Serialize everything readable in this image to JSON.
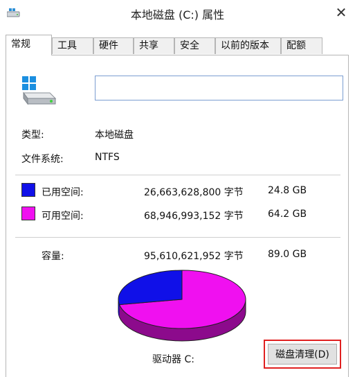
{
  "window": {
    "title": "本地磁盘 (C:) 属性",
    "close_glyph": "✕"
  },
  "tabs": [
    {
      "label": "常规",
      "active": true
    },
    {
      "label": "工具"
    },
    {
      "label": "硬件"
    },
    {
      "label": "共享"
    },
    {
      "label": "安全"
    },
    {
      "label": "以前的版本"
    },
    {
      "label": "配额"
    }
  ],
  "general": {
    "name_value": "",
    "type_label": "类型:",
    "type_value": "本地磁盘",
    "fs_label": "文件系统:",
    "fs_value": "NTFS"
  },
  "space": {
    "used": {
      "label": "已用空间:",
      "bytes": "26,663,628,800 字节",
      "size": "24.8 GB",
      "color": "#1010e8"
    },
    "free": {
      "label": "可用空间:",
      "bytes": "68,946,993,152 字节",
      "size": "64.2 GB",
      "color": "#f010f0"
    },
    "capacity": {
      "label": "容量:",
      "bytes": "95,610,621,952 字节",
      "size": "89.0 GB"
    },
    "drive_label": "驱动器 C:",
    "cleanup_button": "磁盘清理(D)",
    "used_fraction": 0.2789
  },
  "colors": {
    "used_side": "#0808a0",
    "free_side": "#8c0a8c"
  },
  "icons": {
    "drive": "hard-drive-icon",
    "close": "close-icon"
  }
}
